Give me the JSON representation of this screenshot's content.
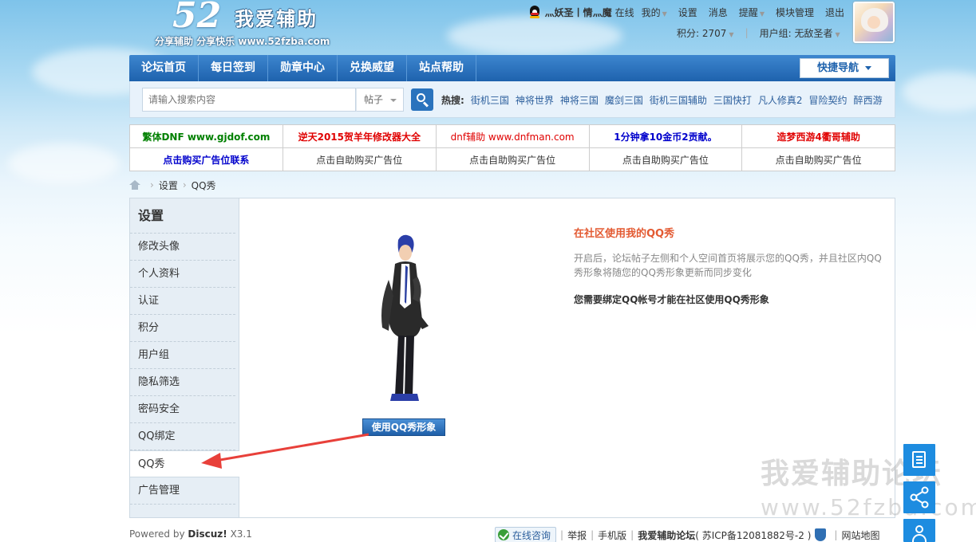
{
  "logo": {
    "number": "52",
    "name": "我爱辅助",
    "slogan": "分享辅助  分享快乐  www.52fzba.com"
  },
  "userbar": {
    "username": "灬妖圣丨情灬魔",
    "status": "在线",
    "links": [
      "我的",
      "设置",
      "消息",
      "提醒",
      "模块管理",
      "退出"
    ],
    "points_label": "积分: 2707",
    "group_label": "用户组: 无敌圣者"
  },
  "nav": {
    "items": [
      "论坛首页",
      "每日签到",
      "勋章中心",
      "兑换威望",
      "站点帮助"
    ],
    "quick_nav": "快捷导航"
  },
  "search": {
    "placeholder": "请输入搜索内容",
    "type": "帖子",
    "hot_label": "热搜:",
    "hot_items": [
      "街机三国",
      "神将世界",
      "神将三国",
      "魔剑三国",
      "街机三国辅助",
      "三国快打",
      "凡人修真2",
      "冒险契约",
      "醉西游"
    ]
  },
  "ads": {
    "row1": [
      {
        "text": "繁体DNF www.gjdof.com",
        "color": "#008000"
      },
      {
        "text": "逆天2015贺羊年修改器大全",
        "color": "#e00000"
      },
      {
        "text": "dnf辅助 www.dnfman.com",
        "color": "#e00000"
      },
      {
        "text": "1分钟拿10金币2贡献。",
        "color": "#0000cc"
      },
      {
        "text": "造梦西游4衢哥辅助",
        "color": "#e00000"
      }
    ],
    "row2": [
      {
        "text": "点击购买广告位联系",
        "color": "#0000cc"
      },
      {
        "text": "点击自助购买广告位",
        "color": "#333333"
      },
      {
        "text": "点击自助购买广告位",
        "color": "#333333"
      },
      {
        "text": "点击自助购买广告位",
        "color": "#333333"
      },
      {
        "text": "点击自助购买广告位",
        "color": "#333333"
      }
    ]
  },
  "breadcrumb": {
    "items": [
      "设置",
      "QQ秀"
    ]
  },
  "sidebar": {
    "title": "设置",
    "items": [
      "修改头像",
      "个人资料",
      "认证",
      "积分",
      "用户组",
      "隐私筛选",
      "密码安全",
      "QQ绑定",
      "QQ秀",
      "广告管理"
    ],
    "active_index": 8
  },
  "content": {
    "heading": "在社区使用我的QQ秀",
    "description": "开启后，论坛帖子左侧和个人空间首页将展示您的QQ秀，并且社区内QQ秀形象将随您的QQ秀形象更新而同步变化",
    "notice": "您需要绑定QQ帐号才能在社区使用QQ秀形象",
    "button": "使用QQ秀形象"
  },
  "footer": {
    "powered_prefix": "Powered by",
    "powered_brand": "Discuz!",
    "powered_version": "X3.1",
    "online_consult": "在线咨询",
    "links": [
      "举报",
      "手机版"
    ],
    "site_name": "我爱辅助论坛",
    "icp": "( 苏ICP备12081882号-2 )",
    "sitemap": "网站地图"
  },
  "watermark": {
    "title": "我爱辅助论坛",
    "url": "www.52fzba.com"
  },
  "colors": {
    "nav_blue": "#1e62ad",
    "accent_orange": "#e35a32",
    "float_blue": "#1d8ce0",
    "arrow_red": "#e8403a"
  }
}
